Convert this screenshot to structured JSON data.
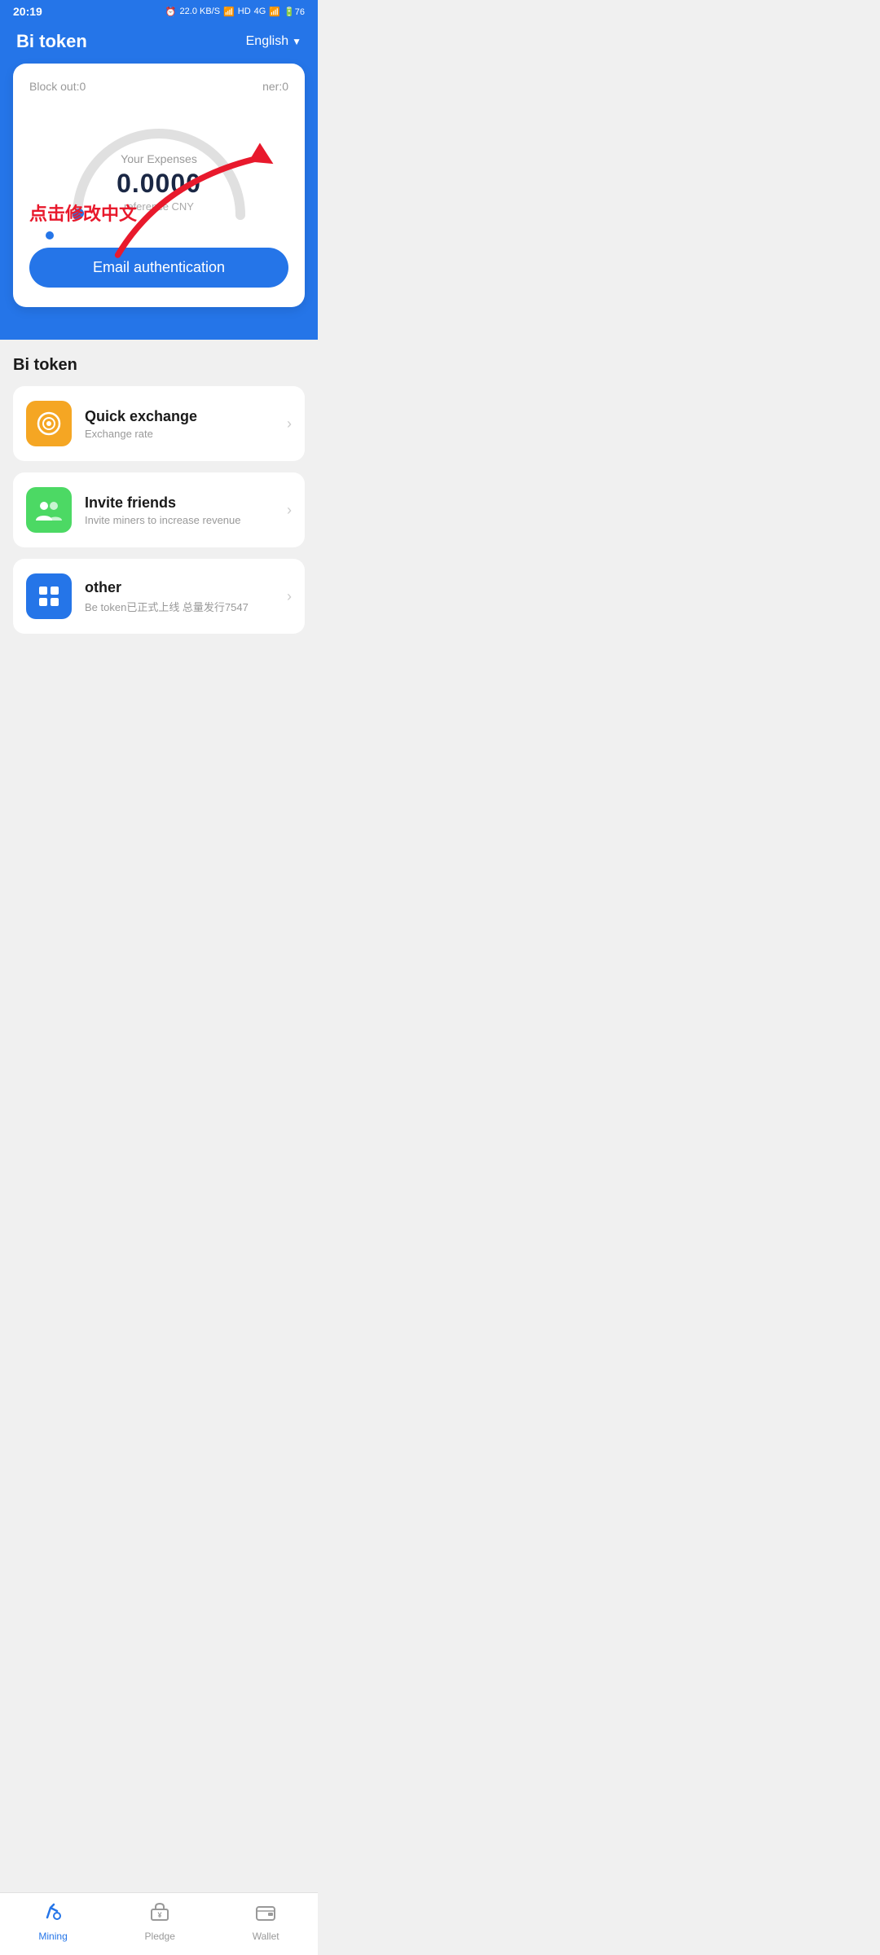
{
  "statusBar": {
    "time": "20:19",
    "icons": "⏰ 22.0 KB/S 📶 HD 4G 4G 76"
  },
  "header": {
    "title": "Bi token",
    "language": "English",
    "languageArrow": "▼"
  },
  "card": {
    "blockOut": "Block out:0",
    "timer": "ner:0",
    "expensesLabel": "Your Expenses",
    "expensesValue": "0.0000",
    "expensesSub": "reference CNY",
    "annotation": "点击修改中文",
    "emailAuthButton": "Email authentication"
  },
  "biTokenSection": {
    "title": "Bi token",
    "items": [
      {
        "id": "quick-exchange",
        "iconColor": "orange",
        "iconSymbol": "🪙",
        "title": "Quick exchange",
        "subtitle": "Exchange rate",
        "arrow": "›"
      },
      {
        "id": "invite-friends",
        "iconColor": "green",
        "iconSymbol": "👥",
        "title": "Invite friends",
        "subtitle": "Invite miners to increase revenue",
        "arrow": "›"
      },
      {
        "id": "other",
        "iconColor": "blue",
        "iconSymbol": "⊞",
        "title": "other",
        "subtitle": "Be token已正式上线 总量发行7547",
        "arrow": "›"
      }
    ]
  },
  "bottomNav": {
    "items": [
      {
        "id": "mining",
        "label": "Mining",
        "active": true
      },
      {
        "id": "pledge",
        "label": "Pledge",
        "active": false
      },
      {
        "id": "wallet",
        "label": "Wallet",
        "active": false
      }
    ]
  }
}
